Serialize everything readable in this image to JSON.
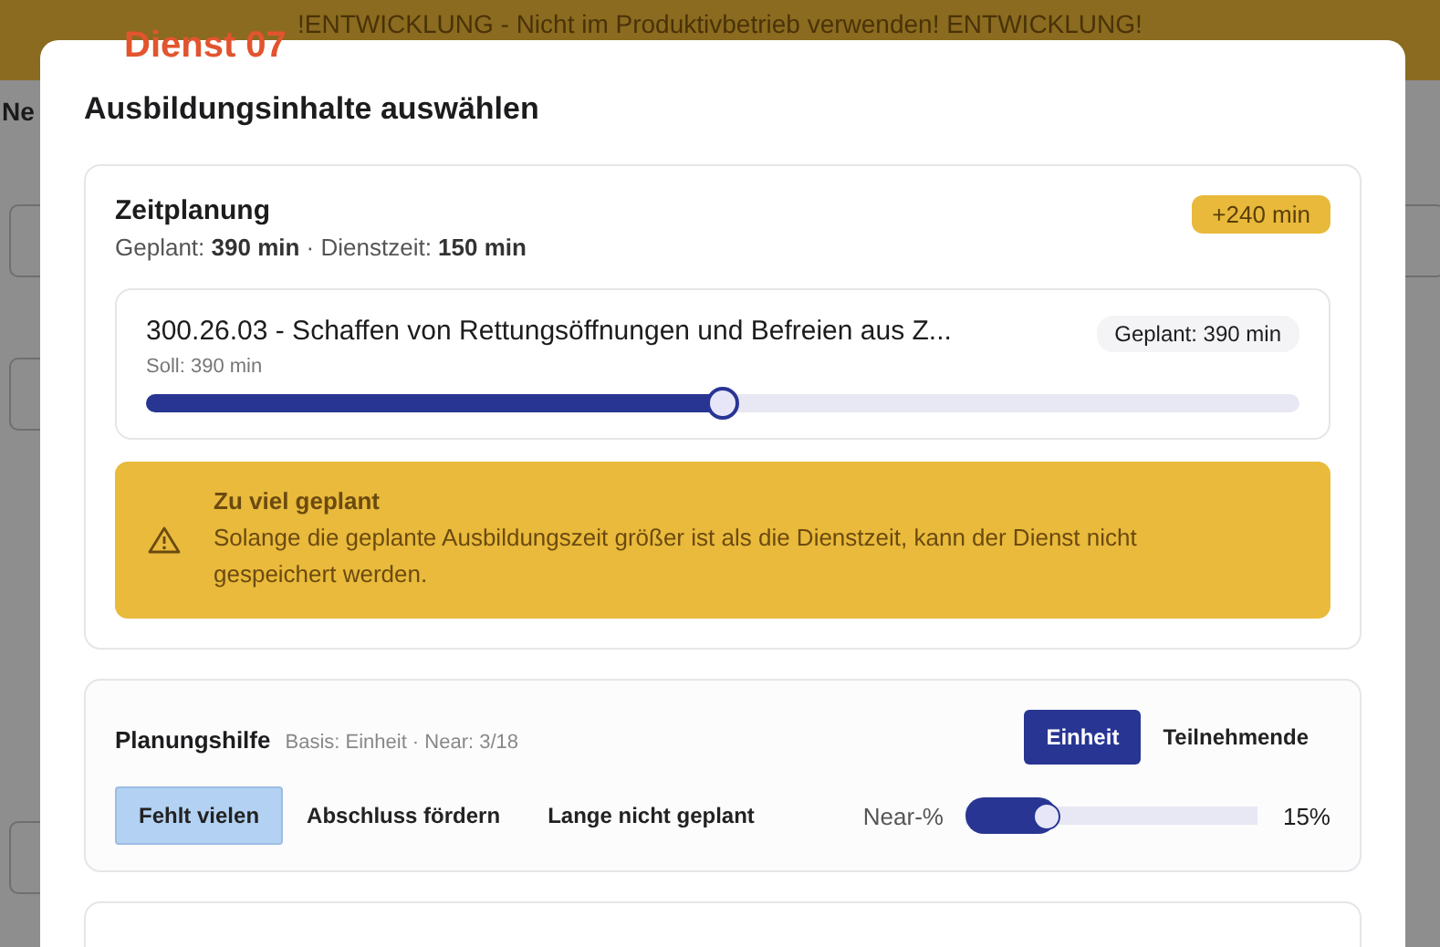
{
  "banner": {
    "text": "!ENTWICKLUNG - Nicht im Produktivbetrieb verwenden! ENTWICKLUNG!"
  },
  "background": {
    "heading": "Ne"
  },
  "overlay_label": "Dienst 07",
  "dialog": {
    "title": "Ausbildungsinhalte auswählen",
    "zeitplanung": {
      "title": "Zeitplanung",
      "summary": "Geplant: **390 min** · Dienstzeit: **150 min**",
      "badge": "+240 min",
      "items": [
        {
          "title": "300.26.03 - Schaffen von Rettungsöffnungen und Befreien aus Z...",
          "target": "Soll: 390 min",
          "planned": "Geplant: 390 min",
          "level": 0.5
        }
      ],
      "warning": {
        "title": "Zu viel geplant",
        "text": "Solange die geplante Ausbildungszeit größer ist als die Dienstzeit, kann der Dienst nicht gespeichert werden."
      }
    },
    "planungshilfe": {
      "title": "Planungshilfe",
      "info": "Basis: Einheit · Near: 3/18",
      "segments": [
        {
          "label": "Einheit",
          "selected": true
        },
        {
          "label": "Teilnehmende",
          "selected": false
        }
      ],
      "filters": [
        {
          "label": "Fehlt vielen",
          "selected": true
        },
        {
          "label": "Abschluss fördern",
          "selected": false
        },
        {
          "label": "Lange nicht geplant",
          "selected": false
        }
      ],
      "near": {
        "label": "Near-%",
        "level": 0.31,
        "reading": "15%"
      }
    }
  }
}
